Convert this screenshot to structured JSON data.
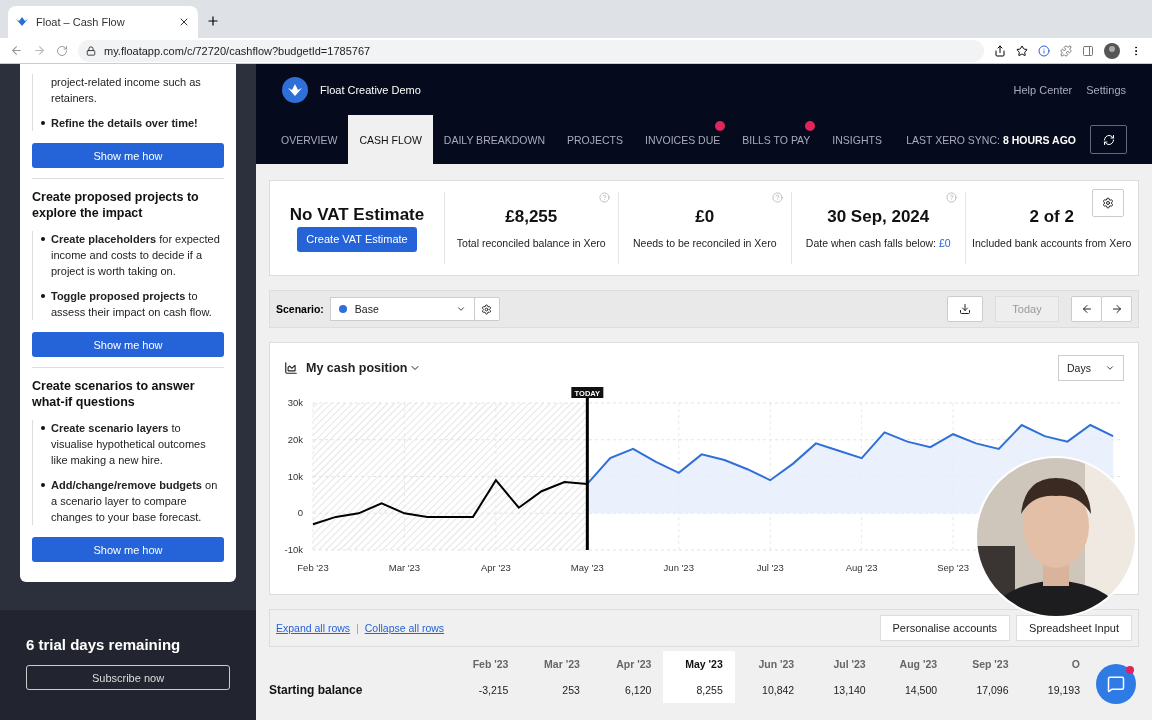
{
  "browser": {
    "tab_title": "Float – Cash Flow",
    "url": "my.floatapp.com/c/72720/cashflow?budgetId=1785767"
  },
  "sidebar": {
    "sections": [
      {
        "bullets": [
          {
            "kind": "continuation",
            "text": "project-related income such as retainers.",
            "bold": false
          },
          {
            "kind": "item",
            "text": "Refine the details over time!",
            "bold": true
          }
        ],
        "button": "Show me how"
      },
      {
        "title": "Create proposed projects to explore the impact",
        "bullets": [
          {
            "kind": "item",
            "text": "**Create placeholders** for expected income and costs to decide if a project is worth taking on.",
            "bold": false
          },
          {
            "kind": "item",
            "text": "**Toggle proposed projects** to assess their impact on cash flow.",
            "bold": false
          }
        ],
        "button": "Show me how"
      },
      {
        "title": "Create scenarios to answer what-if questions",
        "bullets": [
          {
            "kind": "item",
            "text": "**Create scenario layers** to visualise hypothetical outcomes like making a new hire.",
            "bold": false
          },
          {
            "kind": "item",
            "text": "**Add/change/remove budgets** on a scenario layer to compare changes to your base forecast.",
            "bold": false
          }
        ],
        "button": "Show me how"
      }
    ],
    "trial": {
      "text": "6 trial days remaining",
      "button": "Subscribe now"
    }
  },
  "header": {
    "org_name": "Float Creative Demo",
    "links": [
      "Help Center",
      "Settings"
    ],
    "tabs": [
      {
        "label": "OVERVIEW",
        "selected": false,
        "alert": false
      },
      {
        "label": "CASH FLOW",
        "selected": true,
        "alert": false
      },
      {
        "label": "DAILY BREAKDOWN",
        "selected": false,
        "alert": false
      },
      {
        "label": "PROJECTS",
        "selected": false,
        "alert": false
      },
      {
        "label": "INVOICES DUE",
        "selected": false,
        "alert": true
      },
      {
        "label": "BILLS TO PAY",
        "selected": false,
        "alert": true
      },
      {
        "label": "INSIGHTS",
        "selected": false,
        "alert": false
      }
    ],
    "sync": {
      "label": "LAST XERO SYNC:",
      "value": "8 HOURS AGO"
    }
  },
  "summary": {
    "vat": {
      "title": "No VAT Estimate",
      "button": "Create VAT Estimate"
    },
    "stats": [
      {
        "value": "£8,255",
        "label": "Total reconciled balance in Xero",
        "help": true
      },
      {
        "value": "£0",
        "label": "Needs to be reconciled in Xero",
        "help": true
      },
      {
        "value": "30 Sep, 2024",
        "label": "Date when cash falls below:",
        "link": "£0",
        "help": true
      },
      {
        "value": "2 of 2",
        "label": "Included bank accounts from Xero",
        "help": false
      }
    ]
  },
  "scenario": {
    "label": "Scenario:",
    "value": "Base",
    "today": {
      "label": "Today",
      "disabled": true
    }
  },
  "chart": {
    "title": "My cash position",
    "period": "Days",
    "marker": "TODAY",
    "chart_data": {
      "type": "line",
      "categories": [
        "Feb '23",
        null,
        null,
        null,
        "Mar '23",
        null,
        null,
        null,
        "Apr '23",
        null,
        null,
        null,
        "May '23",
        null,
        null,
        null,
        "Jun '23",
        null,
        null,
        null,
        "Jul '23",
        null,
        null,
        null,
        "Aug '23",
        null,
        null,
        null,
        "Sep '23",
        null,
        null,
        null,
        null,
        null,
        null,
        null
      ],
      "ylim": [
        -10000,
        30000
      ],
      "grid": true,
      "yticks": [
        {
          "value": -10000,
          "label": "-10k"
        },
        {
          "value": 0,
          "label": "0"
        },
        {
          "value": 10000,
          "label": "10k"
        },
        {
          "value": 20000,
          "label": "20k"
        },
        {
          "value": 30000,
          "label": "30k"
        }
      ],
      "series": [
        {
          "color": "#000000",
          "values": [
            -3000,
            -1000,
            0,
            2700,
            0,
            -1000,
            -1000,
            -1000,
            9000,
            1500,
            6000,
            8500,
            8000,
            null,
            null,
            null,
            null,
            null,
            null,
            null,
            null,
            null,
            null,
            null,
            null,
            null,
            null,
            null,
            null,
            null,
            null,
            null,
            null,
            null,
            null,
            null
          ]
        },
        {
          "color": "#2f6fd8",
          "values": [
            null,
            null,
            null,
            null,
            null,
            null,
            null,
            null,
            null,
            null,
            null,
            null,
            8000,
            15000,
            17500,
            14000,
            11000,
            16000,
            14500,
            12000,
            9000,
            13500,
            19000,
            17000,
            15000,
            22000,
            19500,
            18000,
            21500,
            19000,
            17500,
            24000,
            21000,
            19500,
            24000,
            21000
          ]
        }
      ]
    }
  },
  "table": {
    "links": [
      "Expand all rows",
      "Collapse all rows"
    ],
    "separator": "|",
    "buttons": [
      "Personalise accounts",
      "Spreadsheet Input"
    ],
    "columns": [
      {
        "label": "Feb '23",
        "selected": false
      },
      {
        "label": "Mar '23",
        "selected": false
      },
      {
        "label": "Apr '23",
        "selected": false
      },
      {
        "label": "May '23",
        "selected": true
      },
      {
        "label": "Jun '23",
        "selected": false
      },
      {
        "label": "Jul '23",
        "selected": false
      },
      {
        "label": "Aug '23",
        "selected": false
      },
      {
        "label": "Sep '23",
        "selected": false
      },
      {
        "label": "O",
        "selected": false
      }
    ],
    "rows": [
      {
        "label": "Starting balance",
        "values": [
          "-3,215",
          "253",
          "6,120",
          "8,255",
          "10,842",
          "13,140",
          "14,500",
          "17,096",
          "19,193"
        ]
      }
    ]
  }
}
